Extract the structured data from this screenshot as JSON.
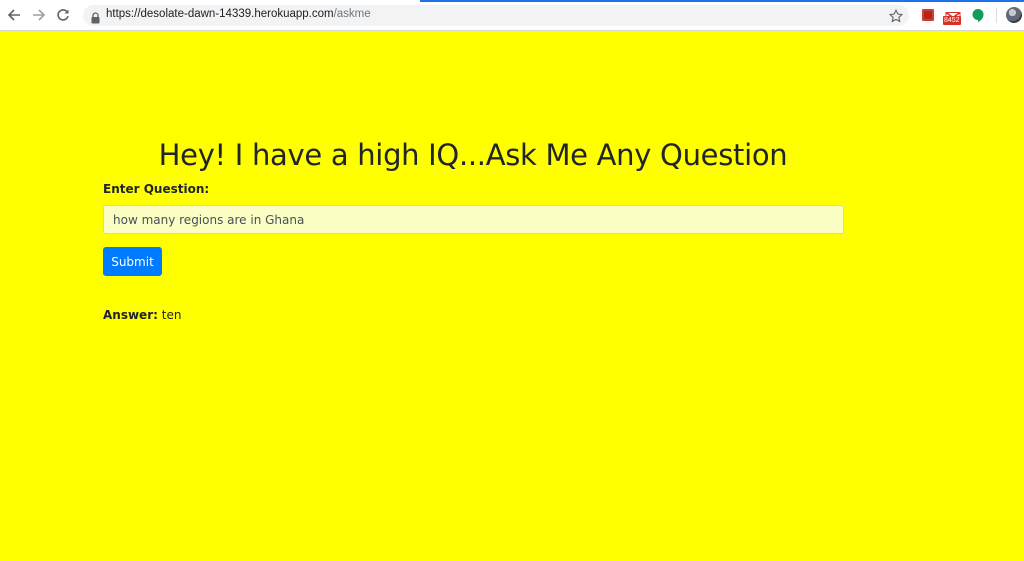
{
  "browser": {
    "url_host": "https://desolate-dawn-14339.herokuapp.com",
    "url_path": "/askme",
    "mail_badge": "8452",
    "accent_color": "#1a73e8"
  },
  "page": {
    "background_color": "#ffff00",
    "heading": "Hey! I have a high IQ...Ask Me Any Question",
    "question_label": "Enter Question:",
    "question_value": "how many regions are in Ghana",
    "submit_label": "Submit",
    "submit_color": "#007bff",
    "answer_label": "Answer:",
    "answer_value": "ten"
  }
}
